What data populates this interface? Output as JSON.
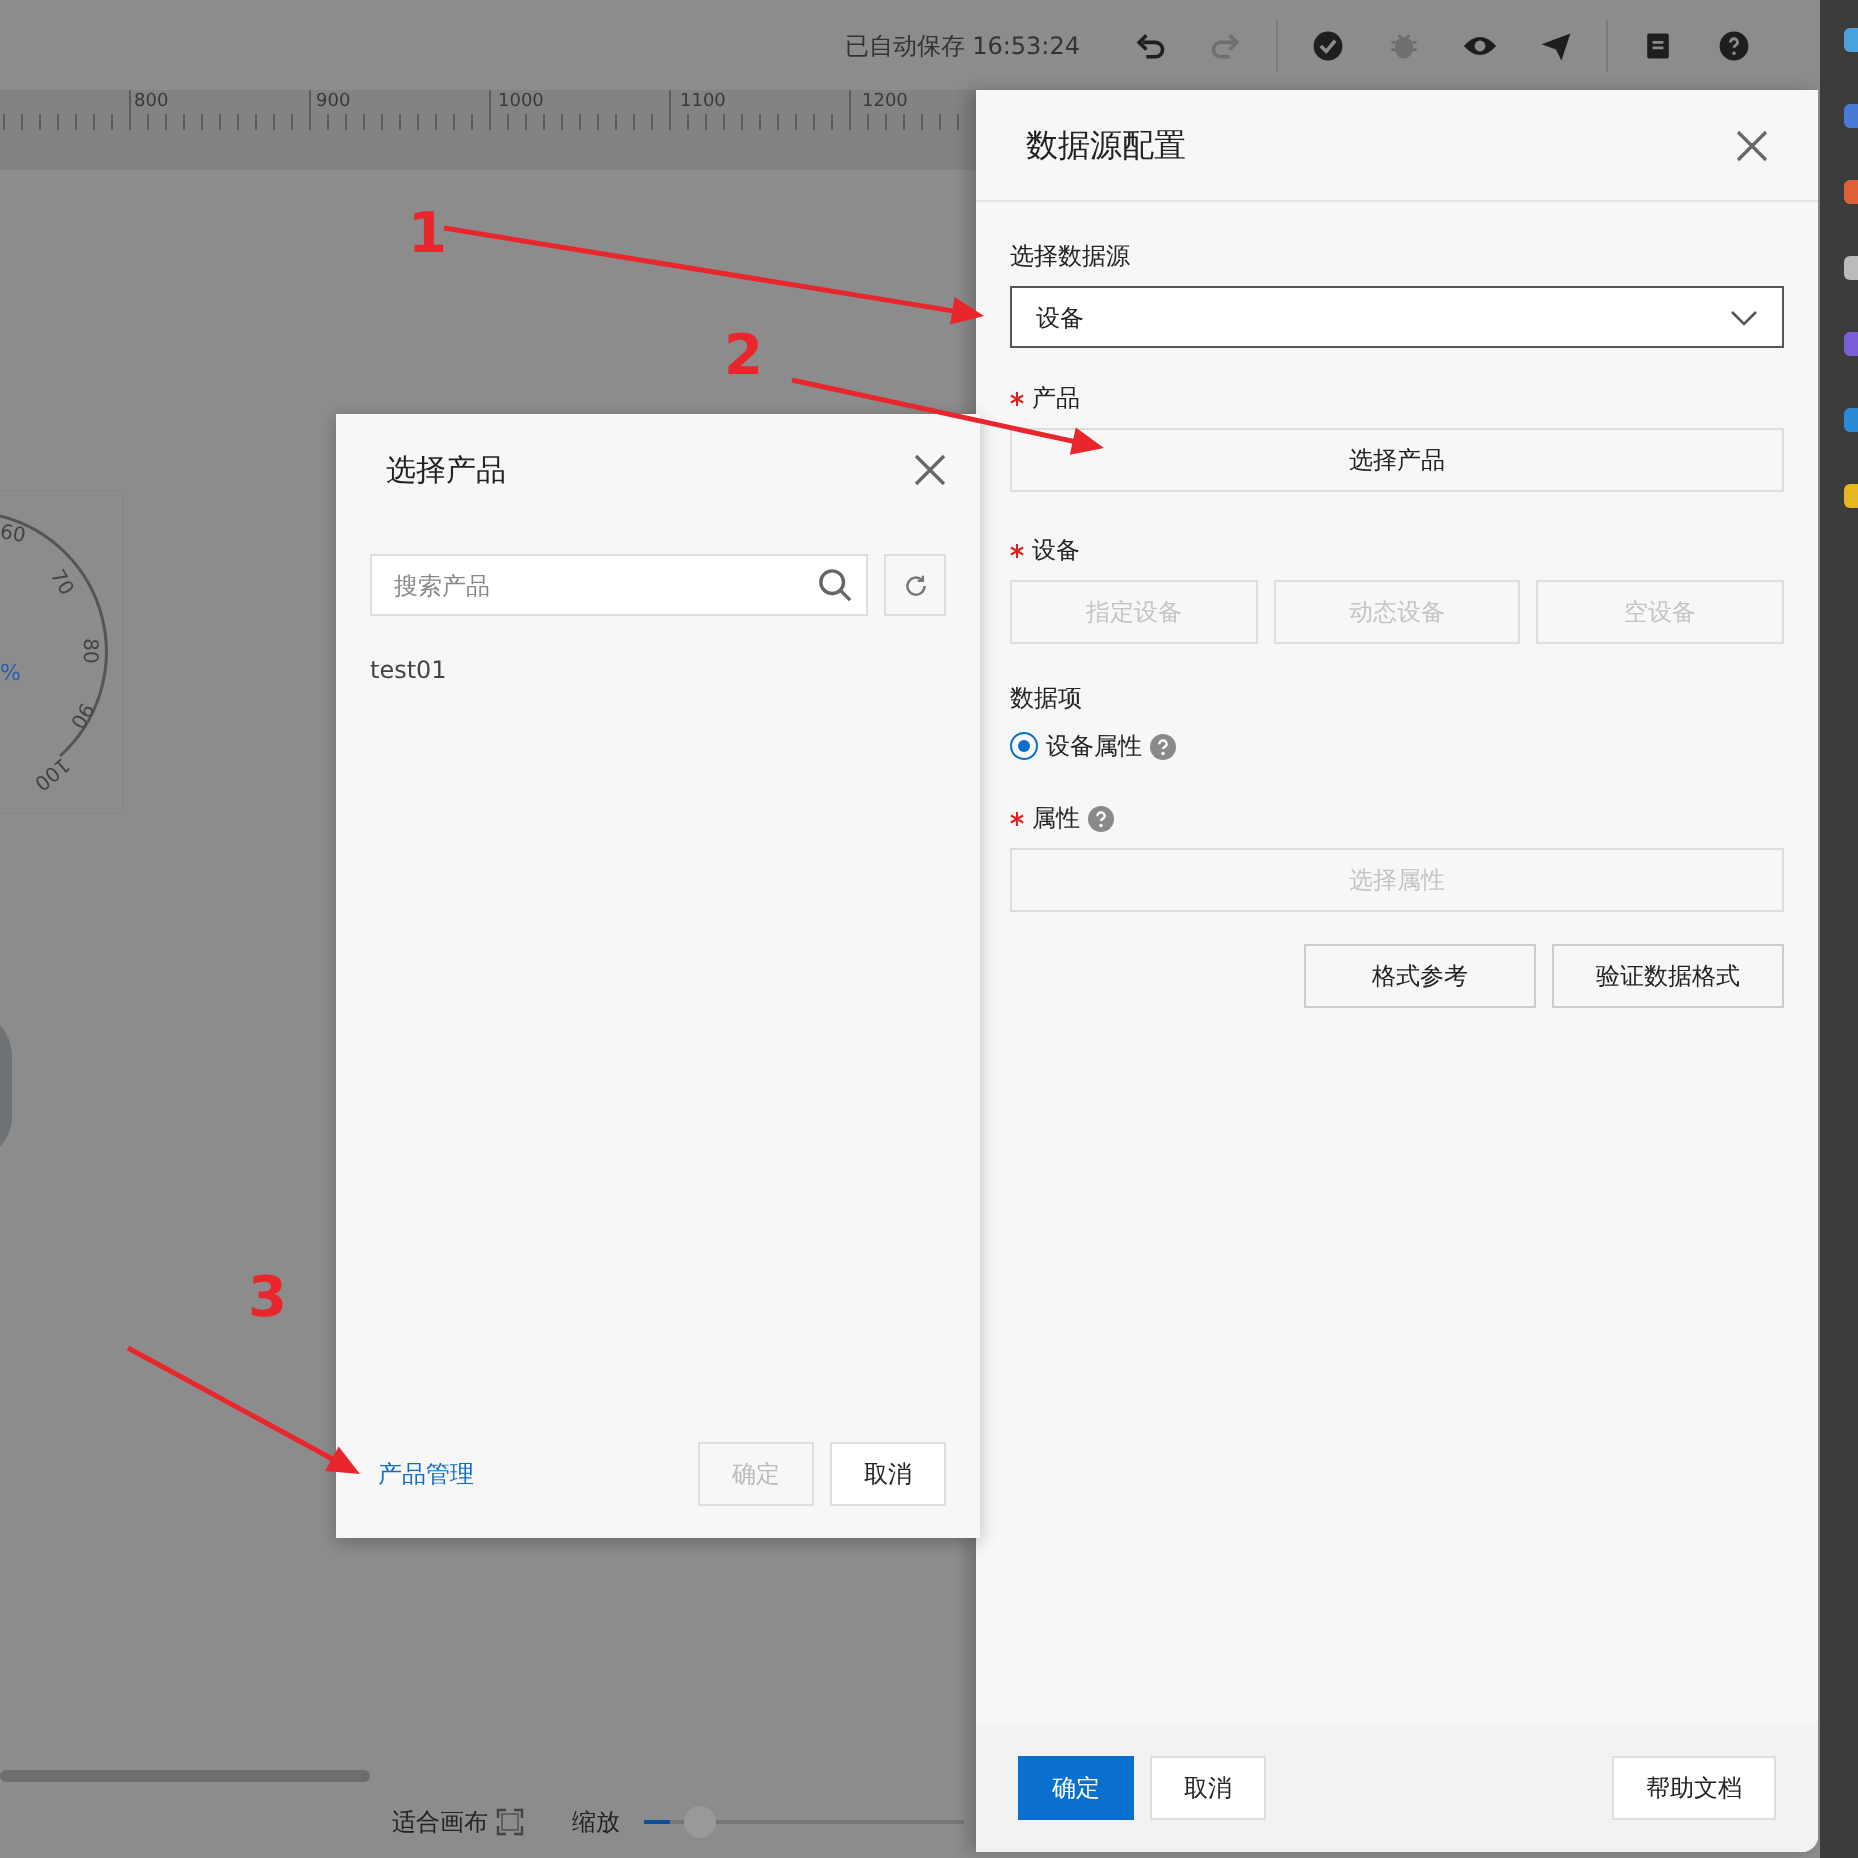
{
  "toolbar": {
    "autosave": "已自动保存 16:53:24",
    "tools": [
      {
        "kind": "undo",
        "disabled": false
      },
      {
        "kind": "redo",
        "disabled": true
      },
      {
        "kind": "check",
        "disabled": false
      },
      {
        "kind": "bug",
        "disabled": true
      },
      {
        "kind": "eye",
        "disabled": false
      },
      {
        "kind": "send",
        "disabled": false
      },
      {
        "kind": "doc",
        "disabled": false
      },
      {
        "kind": "help",
        "disabled": false
      }
    ]
  },
  "ruler": {
    "labels": [
      "800",
      "900",
      "1000",
      "1100",
      "1200"
    ]
  },
  "gauge": {
    "ticks": [
      "60",
      "70",
      "80",
      "90",
      "100"
    ],
    "unit": "%"
  },
  "bottom_bar": {
    "fit": "适合画布",
    "zoom_label": "缩放",
    "zoom": {
      "level": 0.08
    }
  },
  "drawer": {
    "title": "数据源配置",
    "source": {
      "label": "选择数据源",
      "value": "设备"
    },
    "product": {
      "label": "产品",
      "required": true,
      "button": "选择产品"
    },
    "device": {
      "label": "设备",
      "required": true,
      "buttons": [
        {
          "label": "指定设备",
          "disabled": true
        },
        {
          "label": "动态设备",
          "disabled": true
        },
        {
          "label": "空设备",
          "disabled": true
        }
      ]
    },
    "data_item": {
      "label": "数据项",
      "options": [
        {
          "label": "设备属性",
          "selected": true
        }
      ]
    },
    "property": {
      "label": "属性",
      "required": true,
      "button": "选择属性",
      "disabled": true
    },
    "actions": [
      "格式参考",
      "验证数据格式"
    ],
    "footer": {
      "ok": "确定",
      "cancel": "取消",
      "help": "帮助文档"
    }
  },
  "dialog": {
    "title": "选择产品",
    "search": {
      "placeholder": "搜索产品"
    },
    "items": [
      "test01"
    ],
    "manage_link": "产品管理",
    "ok": {
      "label": "确定",
      "disabled": true
    },
    "cancel": "取消"
  },
  "annotations": [
    "1",
    "2",
    "3"
  ]
}
